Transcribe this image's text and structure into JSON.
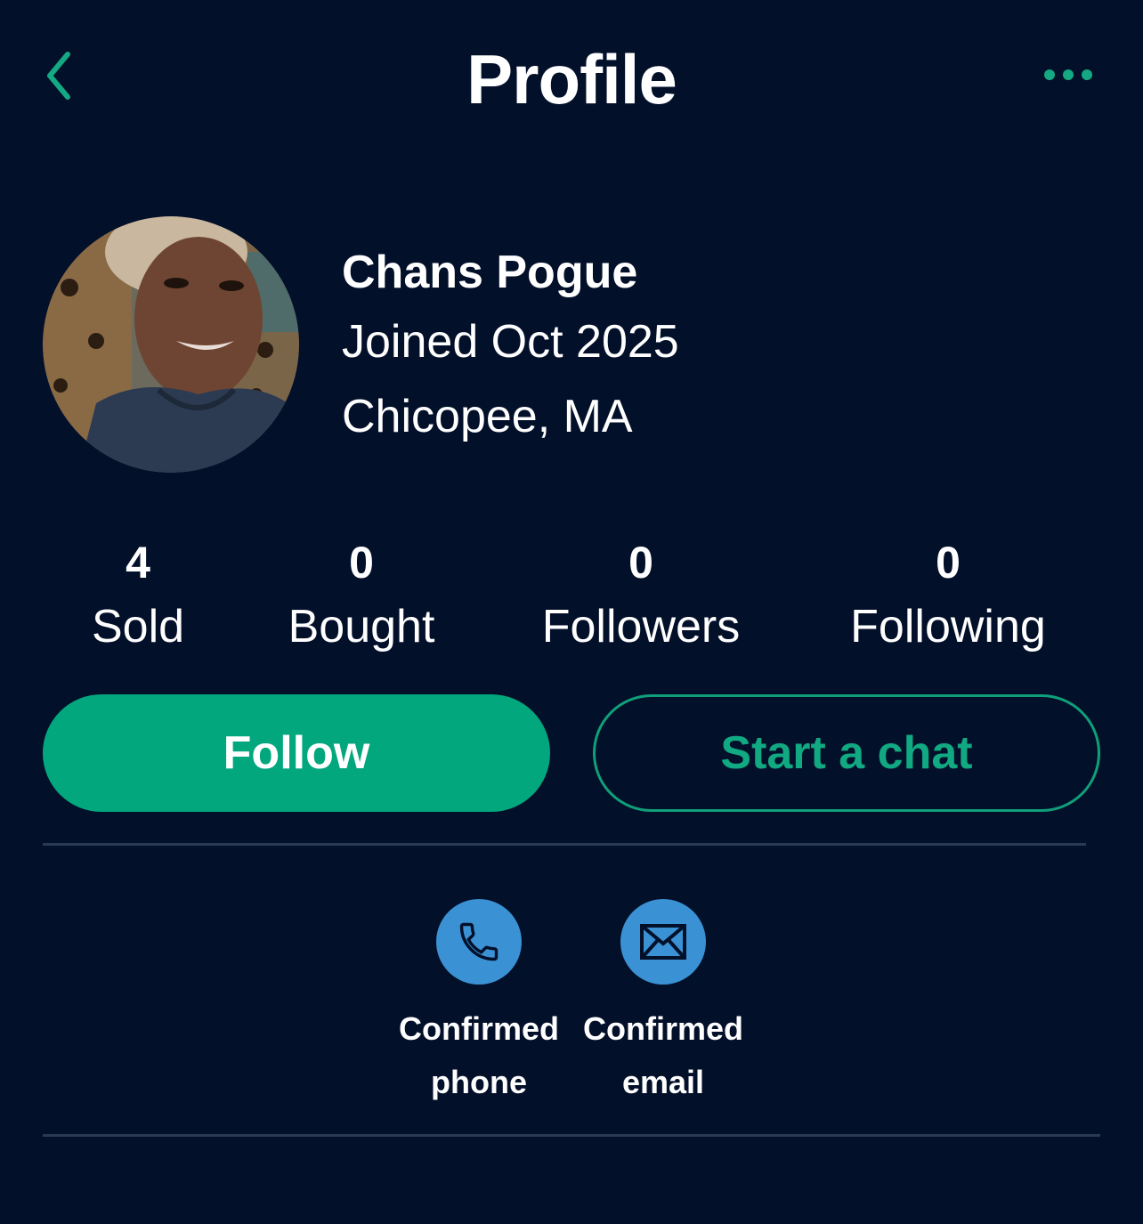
{
  "header": {
    "title": "Profile",
    "back_icon": "chevron-left-icon",
    "more_icon": "more-horizontal-icon"
  },
  "profile": {
    "name": "Chans Pogue",
    "joined": "Joined Oct 2025",
    "location": "Chicopee, MA",
    "avatar_icon": "user-avatar-photo"
  },
  "stats": [
    {
      "count": "4",
      "label": "Sold"
    },
    {
      "count": "0",
      "label": "Bought"
    },
    {
      "count": "0",
      "label": "Followers"
    },
    {
      "count": "0",
      "label": "Following"
    }
  ],
  "actions": {
    "follow_label": "Follow",
    "chat_label": "Start a chat"
  },
  "verifications": [
    {
      "icon": "phone-icon",
      "line1": "Confirmed",
      "line2": "phone"
    },
    {
      "icon": "email-icon",
      "line1": "Confirmed",
      "line2": "email"
    }
  ],
  "colors": {
    "background": "#03102a",
    "accent": "#03a77d",
    "badge": "#3a92d4",
    "divider": "#2a3a55"
  }
}
